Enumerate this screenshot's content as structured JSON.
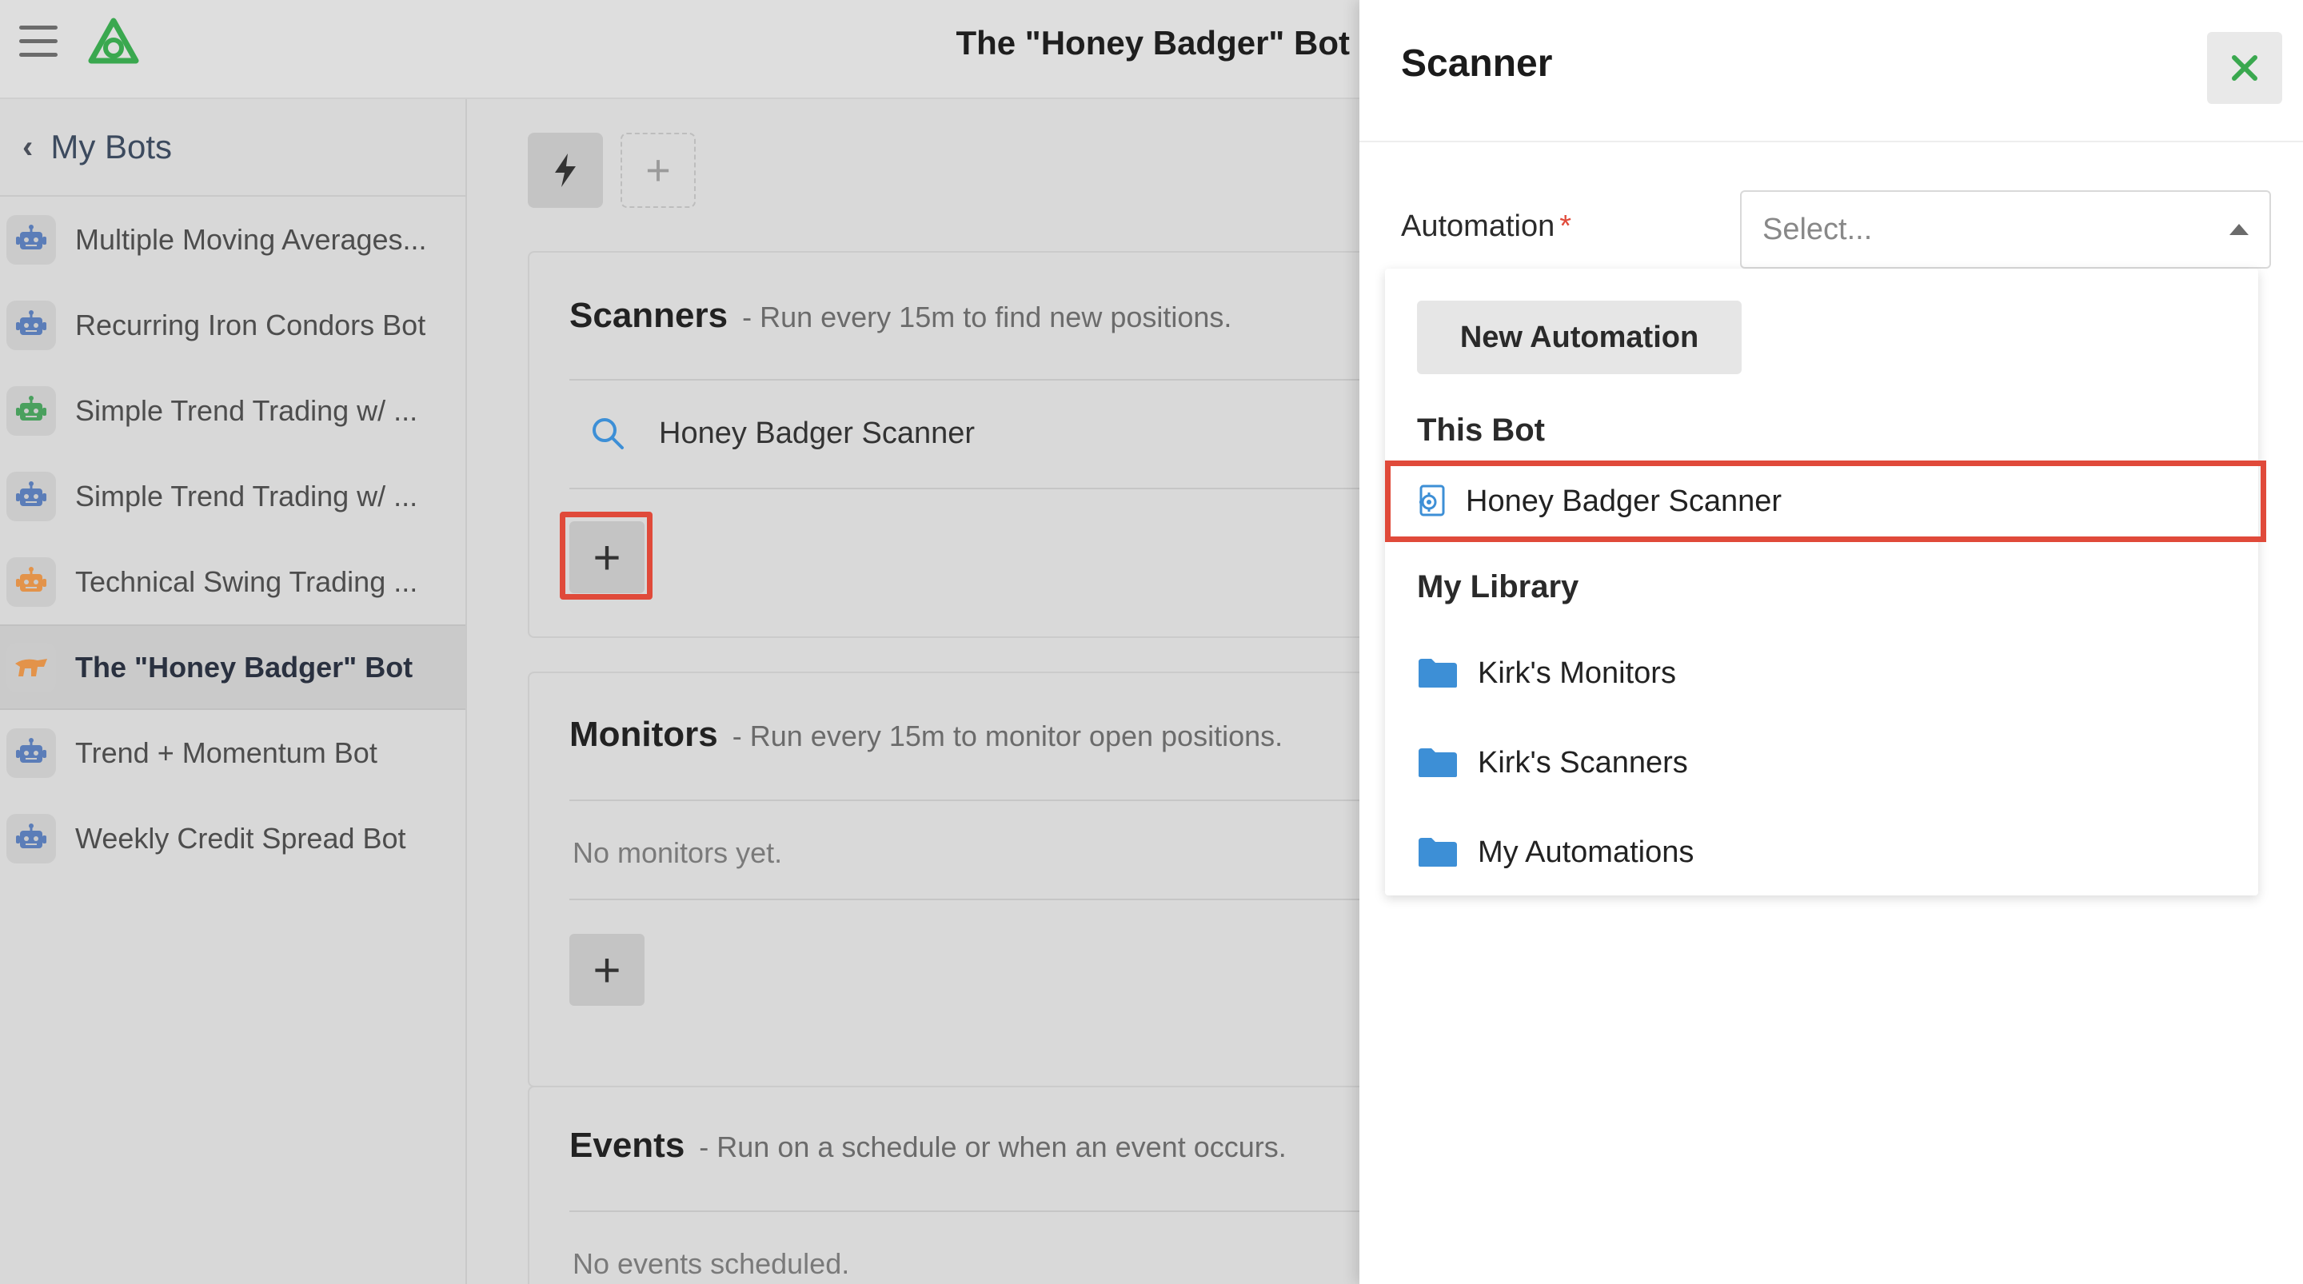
{
  "header": {
    "title": "The \"Honey Badger\" Bot",
    "logo_icon": "tradier-logo-icon",
    "menu_icon": "hamburger-icon"
  },
  "sidebar": {
    "back_label": "My Bots",
    "items": [
      {
        "label": "Multiple Moving Averages...",
        "icon": "robot-icon",
        "color": "#5b7db8"
      },
      {
        "label": "Recurring Iron Condors Bot",
        "icon": "robot-icon",
        "color": "#5b7db8"
      },
      {
        "label": "Simple Trend Trading w/ ...",
        "icon": "robot-icon",
        "color": "#4aa05e"
      },
      {
        "label": "Simple Trend Trading w/ ...",
        "icon": "robot-icon",
        "color": "#5b7db8"
      },
      {
        "label": "Technical Swing Trading ...",
        "icon": "robot-icon",
        "color": "#e3934a"
      },
      {
        "label": "The \"Honey Badger\" Bot",
        "icon": "badger-icon",
        "color": "#e3934a",
        "active": true
      },
      {
        "label": "Trend + Momentum Bot",
        "icon": "robot-icon",
        "color": "#5b7db8"
      },
      {
        "label": "Weekly Credit Spread Bot",
        "icon": "robot-icon",
        "color": "#5b7db8"
      }
    ]
  },
  "main": {
    "scanners": {
      "title": "Scanners",
      "subtitle": "- Run every 15m to find new positions.",
      "items": [
        {
          "label": "Honey Badger Scanner"
        }
      ]
    },
    "monitors": {
      "title": "Monitors",
      "subtitle": "- Run every 15m to monitor open positions.",
      "empty": "No monitors yet."
    },
    "events": {
      "title": "Events",
      "subtitle": "- Run on a schedule or when an event occurs.",
      "empty": "No events scheduled."
    }
  },
  "panel": {
    "title": "Scanner",
    "field_label": "Automation",
    "required_mark": "*",
    "select_placeholder": "Select...",
    "dropdown": {
      "new_button": "New Automation",
      "this_bot_label": "This Bot",
      "this_bot_items": [
        {
          "label": "Honey Badger Scanner"
        }
      ],
      "library_label": "My Library",
      "library_items": [
        {
          "label": "Kirk's Monitors"
        },
        {
          "label": "Kirk's Scanners"
        },
        {
          "label": "My Automations"
        }
      ]
    }
  },
  "colors": {
    "highlight": "#e04a3a",
    "accent_green": "#3aa84f",
    "folder_blue": "#3d8fd6"
  }
}
